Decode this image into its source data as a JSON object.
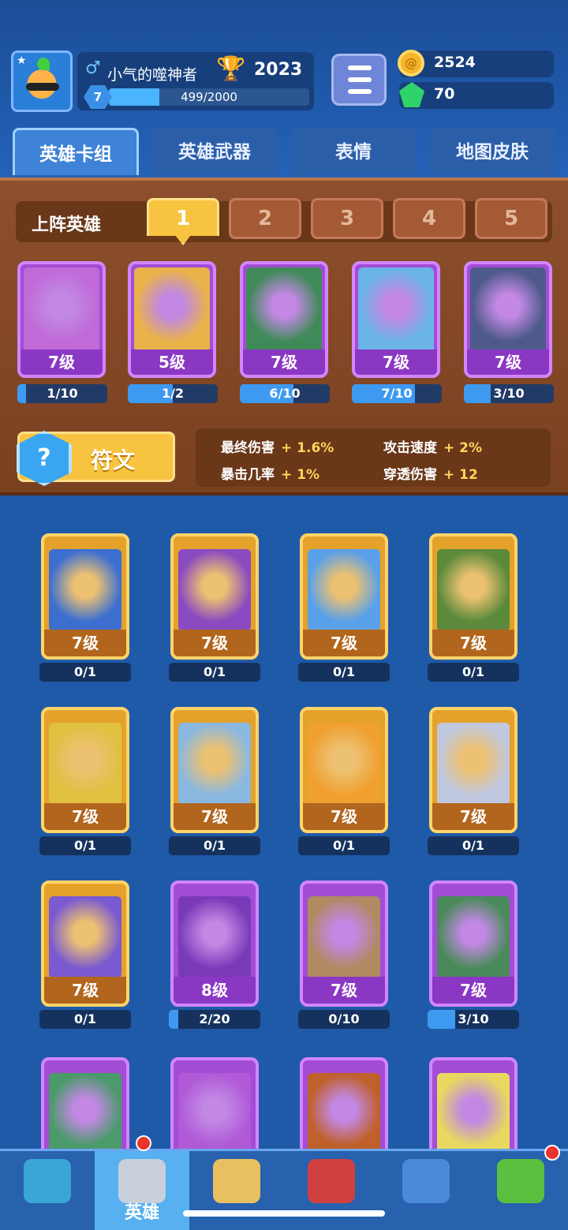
{
  "player": {
    "name": "小气的噬神者",
    "trophies": "2023",
    "level": "7",
    "xp_text": "499/2000",
    "xp_fraction": 0.25
  },
  "currency": {
    "coins": "2524",
    "gems": "70"
  },
  "tabs": [
    "英雄卡组",
    "英雄武器",
    "表情",
    "地图皮肤"
  ],
  "deck": {
    "title": "上阵英雄",
    "slots": [
      "1",
      "2",
      "3",
      "4",
      "5"
    ],
    "cards": [
      {
        "level": "7级",
        "progress": "1/10",
        "fraction": 0.1,
        "color": "#c06ad8"
      },
      {
        "level": "5级",
        "progress": "1/2",
        "fraction": 0.5,
        "color": "#e9b34a"
      },
      {
        "level": "7级",
        "progress": "6/10",
        "fraction": 0.6,
        "color": "#3f8a58"
      },
      {
        "level": "7级",
        "progress": "7/10",
        "fraction": 0.7,
        "color": "#6ab4e8"
      },
      {
        "level": "7级",
        "progress": "3/10",
        "fraction": 0.3,
        "color": "#4d5a8a"
      }
    ],
    "rune_label": "符文",
    "stats": [
      {
        "name": "最终伤害",
        "value": "1.6%"
      },
      {
        "name": "攻击速度",
        "value": "2%"
      },
      {
        "name": "暴击几率",
        "value": "1%"
      },
      {
        "name": "穿透伤害",
        "value": "12"
      }
    ]
  },
  "collection": [
    {
      "level": "7级",
      "progress": "0/1",
      "fraction": 0,
      "rarity": "gold",
      "color": "#3c6fd0"
    },
    {
      "level": "7级",
      "progress": "0/1",
      "fraction": 0,
      "rarity": "gold",
      "color": "#8a4ac0"
    },
    {
      "level": "7级",
      "progress": "0/1",
      "fraction": 0,
      "rarity": "gold",
      "color": "#5aa0e8"
    },
    {
      "level": "7级",
      "progress": "0/1",
      "fraction": 0,
      "rarity": "gold",
      "color": "#5a8a3a"
    },
    {
      "level": "7级",
      "progress": "0/1",
      "fraction": 0,
      "rarity": "gold",
      "color": "#e0c040"
    },
    {
      "level": "7级",
      "progress": "0/1",
      "fraction": 0,
      "rarity": "gold",
      "color": "#8ab8e0"
    },
    {
      "level": "7级",
      "progress": "0/1",
      "fraction": 0,
      "rarity": "gold",
      "color": "#f0a030"
    },
    {
      "level": "7级",
      "progress": "0/1",
      "fraction": 0,
      "rarity": "gold",
      "color": "#c0c8e0"
    },
    {
      "level": "7级",
      "progress": "0/1",
      "fraction": 0,
      "rarity": "gold",
      "color": "#7a5ad0"
    },
    {
      "level": "8级",
      "progress": "2/20",
      "fraction": 0.1,
      "rarity": "purple",
      "color": "#7a3ab8"
    },
    {
      "level": "7级",
      "progress": "0/10",
      "fraction": 0,
      "rarity": "purple",
      "color": "#b08a60"
    },
    {
      "level": "7级",
      "progress": "3/10",
      "fraction": 0.3,
      "rarity": "purple",
      "color": "#4a8a5a"
    },
    {
      "level": "",
      "progress": "",
      "fraction": 0,
      "rarity": "purple",
      "color": "#4a9a6a"
    },
    {
      "level": "",
      "progress": "",
      "fraction": 0,
      "rarity": "purple",
      "color": "#b05ad8"
    },
    {
      "level": "",
      "progress": "",
      "fraction": 0,
      "rarity": "purple",
      "color": "#c0602a"
    },
    {
      "level": "",
      "progress": "",
      "fraction": 0,
      "rarity": "purple",
      "color": "#e8d860"
    }
  ],
  "nav": [
    {
      "label": "",
      "icon": "treasure-chest-icon",
      "color": "#3aa6d8"
    },
    {
      "label": "英雄",
      "icon": "knight-helmet-icon",
      "color": "#c8d0dc"
    },
    {
      "label": "",
      "icon": "crossed-swords-icon",
      "color": "#e8c060"
    },
    {
      "label": "",
      "icon": "crown-shield-icon",
      "color": "#d04040"
    },
    {
      "label": "",
      "icon": "friends-banner-icon",
      "color": "#4a8ad8"
    },
    {
      "label": "",
      "icon": "sprout-island-icon",
      "color": "#5ac040"
    }
  ]
}
